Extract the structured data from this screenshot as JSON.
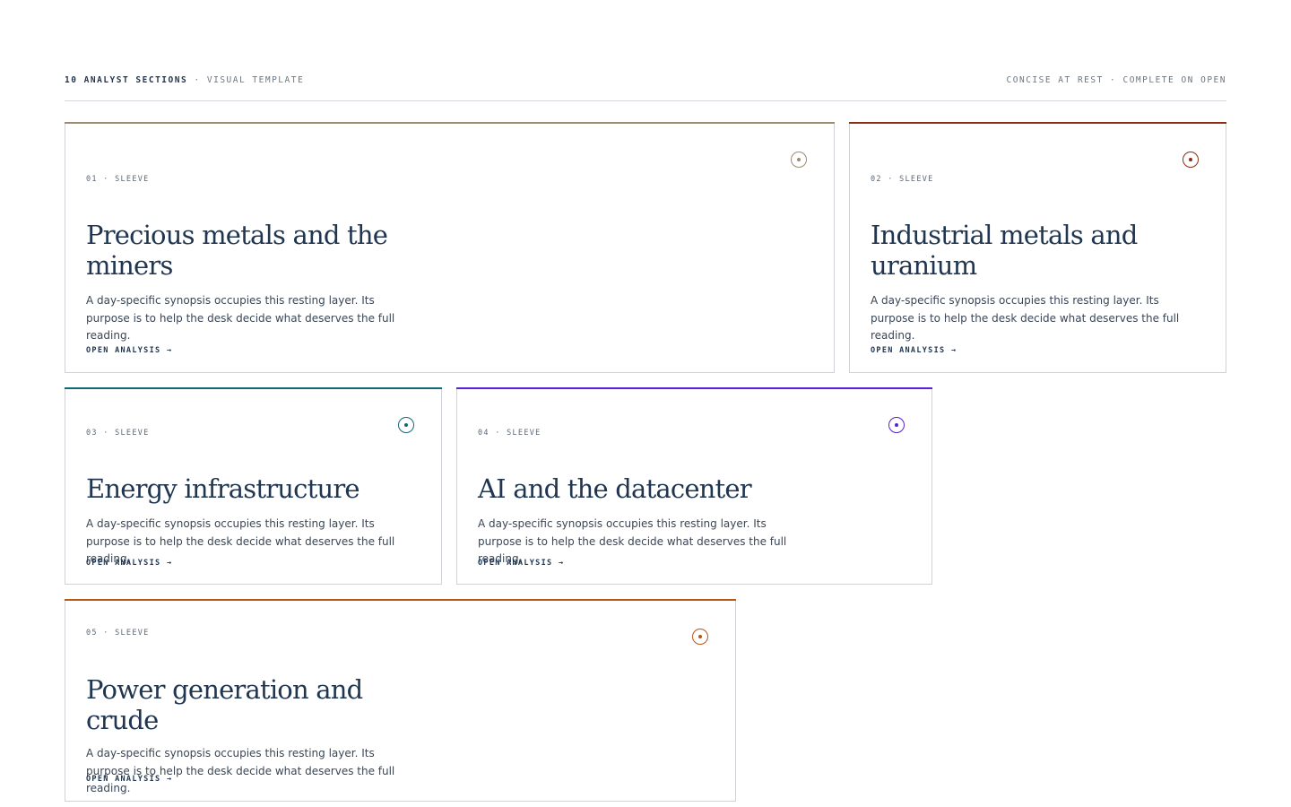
{
  "header": {
    "count_label": "10 ANALYST SECTIONS",
    "separator": "·",
    "subtitle": "VISUAL TEMPLATE",
    "tagline": "CONCISE AT REST · COMPLETE ON OPEN"
  },
  "cards": [
    {
      "eyebrow": "01 · SLEEVE",
      "title": "Precious metals and the miners",
      "synopsis": "A day-specific synopsis occupies this resting layer. Its purpose is to help the desk decide what deserves the full reading.",
      "cta": "OPEN ANALYSIS →",
      "accent_color": "#9c8a72",
      "marker_icon": "status-dot-icon"
    },
    {
      "eyebrow": "02 · SLEEVE",
      "title": "Industrial metals and uranium",
      "synopsis": "A day-specific synopsis occupies this resting layer. Its purpose is to help the desk decide what deserves the full reading.",
      "cta": "OPEN ANALYSIS →",
      "accent_color": "#8c2e12",
      "marker_icon": "status-dot-icon"
    },
    {
      "eyebrow": "03 · SLEEVE",
      "title": "Energy infrastructure",
      "synopsis": "A day-specific synopsis occupies this resting layer. Its purpose is to help the desk decide what deserves the full reading.",
      "cta": "OPEN ANALYSIS →",
      "accent_color": "#0f6a78",
      "marker_icon": "status-dot-icon"
    },
    {
      "eyebrow": "04 · SLEEVE",
      "title": "AI and the datacenter",
      "synopsis": "A day-specific synopsis occupies this resting layer. Its purpose is to help the desk decide what deserves the full reading.",
      "cta": "OPEN ANALYSIS →",
      "accent_color": "#5a1fd6",
      "marker_icon": "status-dot-icon"
    },
    {
      "eyebrow": "05 · SLEEVE",
      "title": "Power generation and crude",
      "synopsis": "A day-specific synopsis occupies this resting layer. Its purpose is to help the desk decide what deserves the full reading.",
      "cta": "OPEN ANALYSIS →",
      "accent_color": "#b5561b",
      "marker_icon": "status-dot-icon"
    }
  ]
}
